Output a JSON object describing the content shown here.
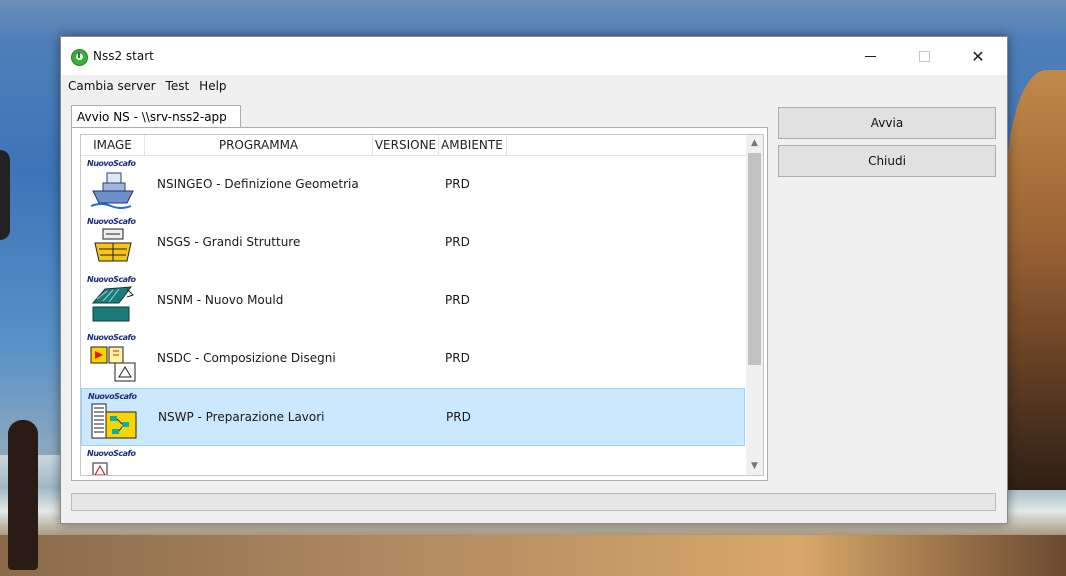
{
  "window": {
    "title": "Nss2 start",
    "controls": {
      "minimize": "—",
      "close": "✕"
    }
  },
  "menu": [
    "Cambia server",
    "Test",
    "Help"
  ],
  "tab": {
    "label": "Avvio NS - \\\\srv-nss2-app"
  },
  "list": {
    "columns": [
      "IMAGE",
      "PROGRAMMA",
      "VERSIONE",
      "AMBIENTE"
    ],
    "rows": [
      {
        "icon": "ship-icon",
        "brand": "NuovoScafo",
        "program": "NSINGEO - Definizione Geometria",
        "version": "",
        "environment": "PRD",
        "selected": false
      },
      {
        "icon": "structure-icon",
        "brand": "NuovoScafo",
        "program": "NSGS - Grandi Strutture",
        "version": "",
        "environment": "PRD",
        "selected": false
      },
      {
        "icon": "mould-icon",
        "brand": "NuovoScafo",
        "program": "NSNM - Nuovo Mould",
        "version": "",
        "environment": "PRD",
        "selected": false
      },
      {
        "icon": "drawing-icon",
        "brand": "NuovoScafo",
        "program": "NSDC - Composizione Disegni",
        "version": "",
        "environment": "PRD",
        "selected": false
      },
      {
        "icon": "workflow-icon",
        "brand": "NuovoScafo",
        "program": "NSWP - Preparazione Lavori",
        "version": "",
        "environment": "PRD",
        "selected": true
      },
      {
        "icon": "partial-icon",
        "brand": "NuovoScafo",
        "program": "",
        "version": "",
        "environment": "",
        "selected": false
      }
    ]
  },
  "buttons": {
    "start": "Avvia",
    "close": "Chiudi"
  },
  "progress": {
    "value": 0
  },
  "colors": {
    "selection": "#cce8ff",
    "accent": "#3aae3a"
  }
}
